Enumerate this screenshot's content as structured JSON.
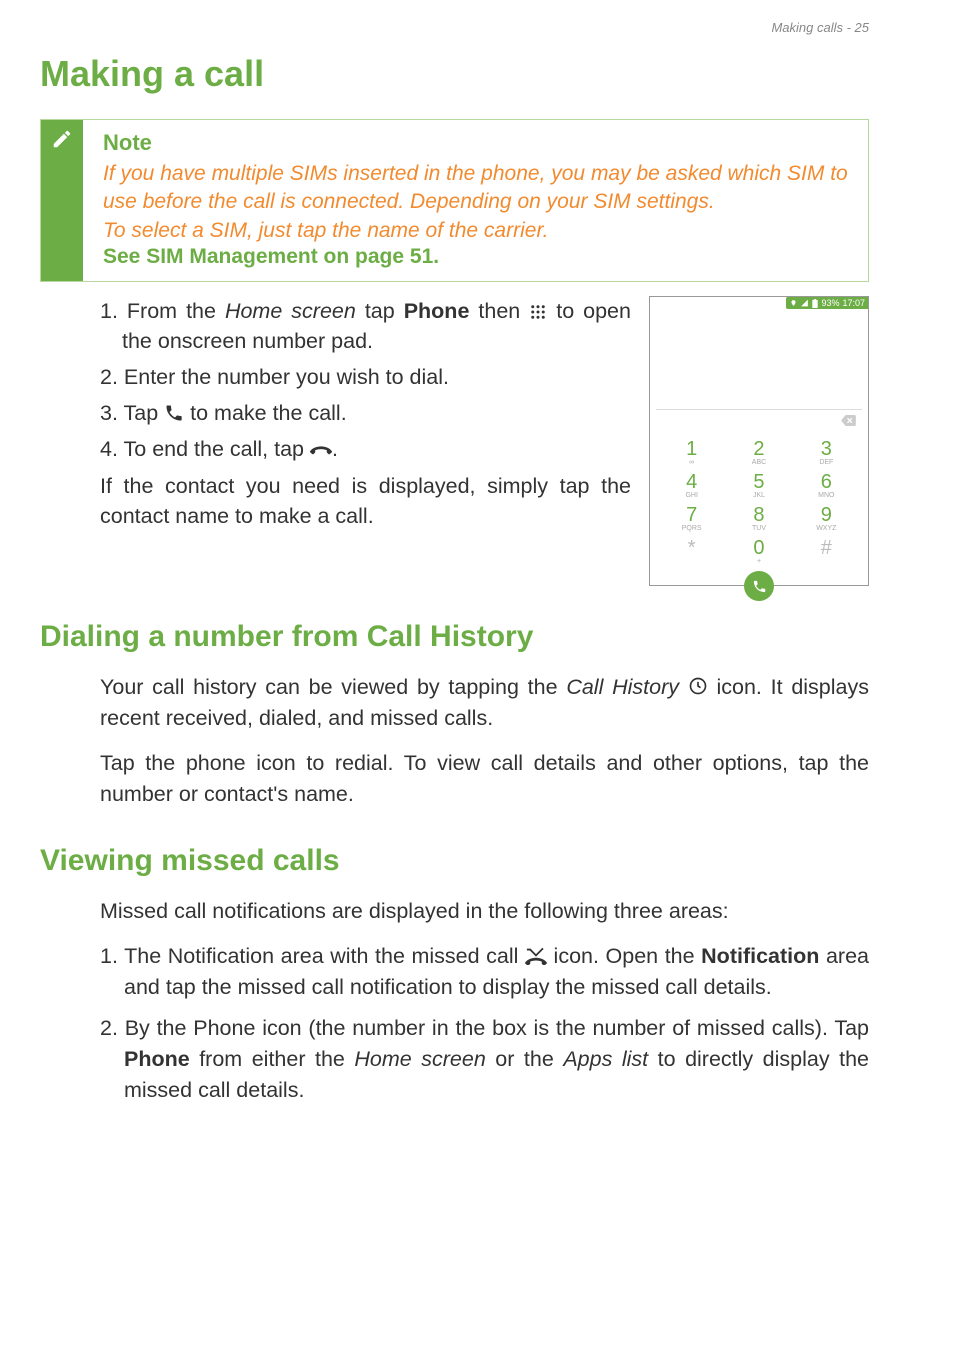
{
  "header": {
    "text": "Making calls - 25"
  },
  "title": "Making a call",
  "note": {
    "title": "Note",
    "body1": "If you have multiple SIMs inserted in the phone, you may be asked which SIM to use before the call is connected. Depending on your SIM settings.",
    "body2": "To select a SIM, just tap the name of the carrier.",
    "link": "See SIM Management on page 51"
  },
  "steps": {
    "s1a": "1. From the ",
    "s1b": "Home screen",
    "s1c": " tap ",
    "s1d": "Phone",
    "s1e": " then ",
    "s1f": " to open the onscreen number pad.",
    "s2": "2. Enter the number you wish to dial.",
    "s3a": "3. Tap ",
    "s3b": " to make the call.",
    "s4a": "4. To end the call, tap ",
    "s4b": ".",
    "para": "If the contact you need is displayed, simply tap the contact name to make a call."
  },
  "screenshot": {
    "status": {
      "time": "17:07",
      "battery": "93%"
    },
    "keys": [
      {
        "n": "1",
        "l": "∞"
      },
      {
        "n": "2",
        "l": "ABC"
      },
      {
        "n": "3",
        "l": "DEF"
      },
      {
        "n": "4",
        "l": "GHI"
      },
      {
        "n": "5",
        "l": "JKL"
      },
      {
        "n": "6",
        "l": "MNO"
      },
      {
        "n": "7",
        "l": "PQRS"
      },
      {
        "n": "8",
        "l": "TUV"
      },
      {
        "n": "9",
        "l": "WXYZ"
      },
      {
        "n": "*",
        "l": ""
      },
      {
        "n": "0",
        "l": "+"
      },
      {
        "n": "#",
        "l": ""
      }
    ]
  },
  "section_dialing": {
    "title": "Dialing a number from Call History",
    "p1a": "Your call history can be viewed by tapping the ",
    "p1b": "Call History",
    "p1c": " ",
    "p1d": " icon. It displays recent received, dialed, and missed calls.",
    "p2": "Tap the phone icon to redial. To view call details and other options, tap the number or contact's name."
  },
  "section_missed": {
    "title": "Viewing missed calls",
    "intro": "Missed call notifications are displayed in the following three areas:",
    "li1a": "1. The Notification area with the missed call ",
    "li1b": " icon. Open the ",
    "li1c": "Notification",
    "li1d": " area and tap the missed call notification to display the missed call details.",
    "li2a": "2. By the Phone icon (the number in the box is the number of missed calls). Tap ",
    "li2b": "Phone",
    "li2c": " from either the ",
    "li2d": "Home screen",
    "li2e": " or the ",
    "li2f": "Apps list",
    "li2g": " to directly display the missed call details."
  }
}
